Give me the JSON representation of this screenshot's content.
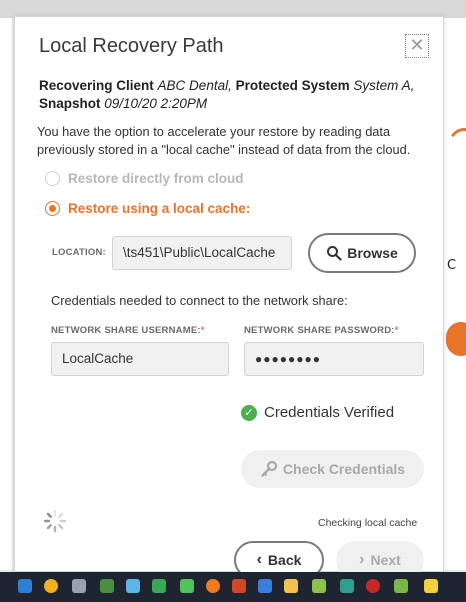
{
  "dialog": {
    "title": "Local Recovery Path",
    "close_glyph": "✕",
    "client": {
      "label": "Recovering Client",
      "value": "ABC Dental,",
      "system_label": "Protected System",
      "system_value": "System A,",
      "snapshot_label": "Snapshot",
      "snapshot_value": "09/10/20 2:20PM"
    },
    "description": "You have the option to accelerate your restore by reading data previously stored in a \"local cache\" instead of data from the cloud.",
    "options": [
      {
        "label": "Restore directly from cloud",
        "selected": false
      },
      {
        "label": "Restore using a local cache:",
        "selected": true
      }
    ],
    "location": {
      "label": "LOCATION:",
      "value": "\\ts451\\Public\\LocalCache"
    },
    "browse_label": "Browse",
    "credentials_intro": "Credentials needed to connect to the network share:",
    "username": {
      "label": "NETWORK SHARE USERNAME:",
      "required_mark": "*",
      "value": "LocalCache"
    },
    "password": {
      "label": "NETWORK SHARE PASSWORD:",
      "required_mark": "*",
      "value": "●●●●●●●●"
    },
    "verified_text": "Credentials Verified",
    "check_credentials_label": "Check Credentials",
    "status_text": "Checking local cache",
    "back_label": "Back",
    "next_label": "Next"
  },
  "background": {
    "letter": "C"
  },
  "colors": {
    "accent": "#e8742a",
    "success": "#4caf50",
    "taskbar": "#1f2530"
  },
  "taskbar": {
    "icons": [
      "start-icon",
      "chrome-icon",
      "settings-icon",
      "app-icon",
      "image-icon",
      "sheets-icon",
      "firefox-icon",
      "powerpoint-icon",
      "monitor-icon",
      "explorer-icon",
      "app-icon",
      "vpn-icon",
      "network-icon",
      "app-icon",
      "vivaldi-icon",
      "tool-icon",
      "app-icon"
    ]
  }
}
